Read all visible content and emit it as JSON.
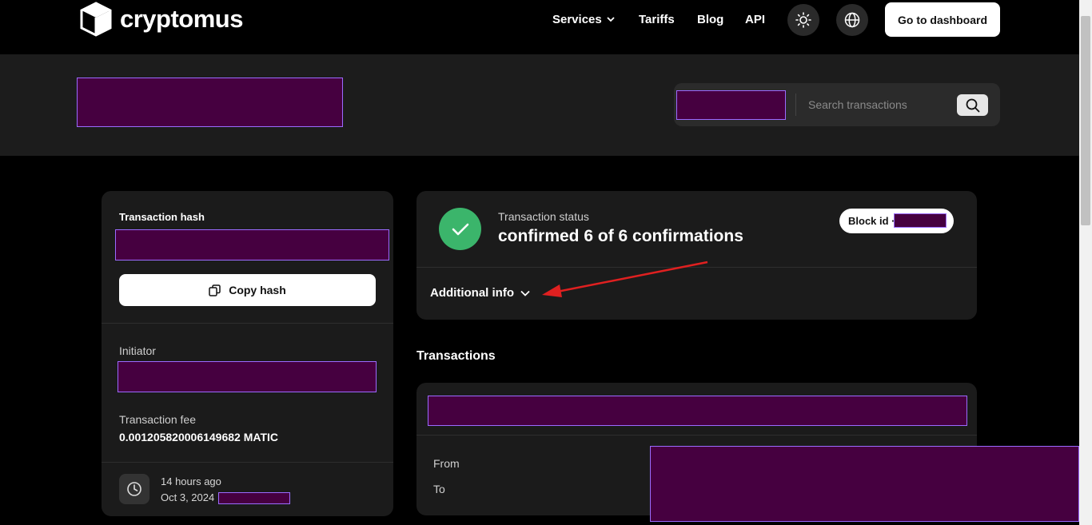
{
  "header": {
    "logo_text": "cryptomus",
    "nav": {
      "services": "Services",
      "tariffs": "Tariffs",
      "blog": "Blog",
      "api": "API"
    },
    "dashboard_label": "Go to dashboard"
  },
  "search": {
    "placeholder": "Search transactions"
  },
  "left_card": {
    "hash_label": "Transaction hash",
    "copy_label": "Copy hash",
    "initiator_label": "Initiator",
    "fee_label": "Transaction fee",
    "fee_value": "0.001205820006149682 MATIC",
    "time_ago": "14 hours ago",
    "date": "Oct 3, 2024"
  },
  "status_card": {
    "status_label": "Transaction status",
    "status_value": "confirmed 6 of 6 confirmations",
    "block_label": "Block id ·",
    "additional_info": "Additional info"
  },
  "transactions": {
    "title": "Transactions",
    "from_label": "From",
    "to_label": "To"
  },
  "colors": {
    "accent_green": "#3bb56b",
    "annotation_red": "#e02020"
  }
}
